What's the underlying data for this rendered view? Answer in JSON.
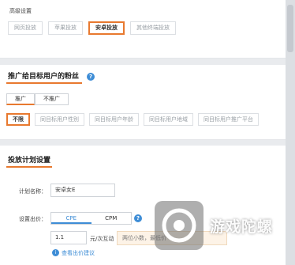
{
  "advanced": {
    "title": "高级设置",
    "options": [
      {
        "label": "网页投放",
        "active": false
      },
      {
        "label": "苹果投放",
        "active": false
      },
      {
        "label": "安卓投放",
        "active": true
      },
      {
        "label": "其他终端投放",
        "active": false
      }
    ]
  },
  "audience": {
    "title": "推广给目标用户的粉丝",
    "help_icon": "question-icon",
    "toggle": [
      {
        "label": "推广",
        "active": true
      },
      {
        "label": "不推广",
        "active": false
      }
    ],
    "filters": [
      {
        "label": "不限",
        "active": true
      },
      {
        "label": "同目标用户性别",
        "active": false
      },
      {
        "label": "同目标用户年龄",
        "active": false
      },
      {
        "label": "同目标用户地域",
        "active": false
      },
      {
        "label": "同目标用户推广平台",
        "active": false
      }
    ]
  },
  "plan": {
    "title": "投放计划设置",
    "name_label": "计划名称：",
    "name_value": "安卓女E",
    "bid_label": "设置出价：",
    "bid_modes": [
      {
        "label": "CPE",
        "active": true
      },
      {
        "label": "CPM",
        "active": false
      }
    ],
    "bid_value": "1.1",
    "bid_unit": "元/次互动",
    "bid_hint": "两位小数，最低价",
    "suggest_link": "查看出价建议"
  },
  "watermark": {
    "text": "游戏陀螺"
  },
  "colors": {
    "accent": "#e8792f",
    "link": "#3e8dd6"
  }
}
